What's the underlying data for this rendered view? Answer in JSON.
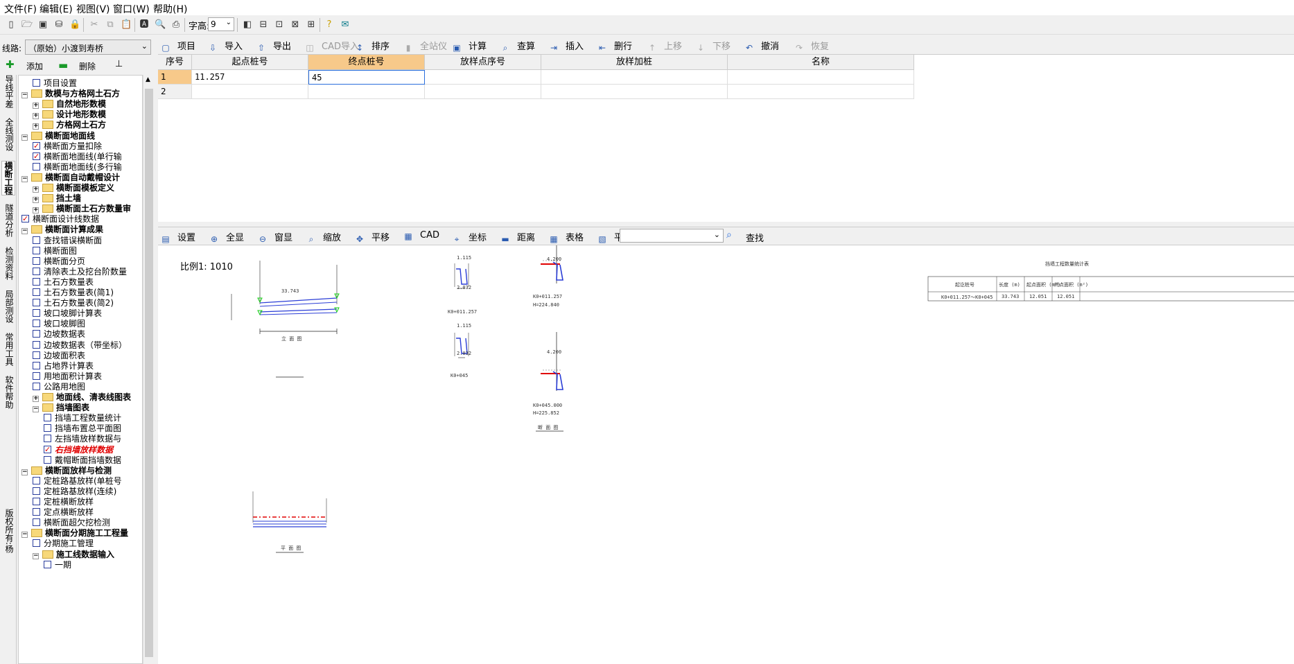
{
  "menu": [
    "文件(F)",
    "编辑(E)",
    "视图(V)",
    "窗口(W)",
    "帮助(H)"
  ],
  "toolbar1": {
    "font_height_label": "字高:",
    "font_height_value": "9"
  },
  "route": {
    "label": "线路:",
    "value": "（原始）小渡到寿桥"
  },
  "tree_actions": {
    "add": "添加",
    "delete": "删除"
  },
  "rail_tabs": [
    "导线平差",
    "全线测设",
    "横断工程",
    "隧道分析",
    "检测资料",
    "局部测设",
    "常用工具",
    "软件帮助",
    "版权所有:杨"
  ],
  "tree": [
    {
      "label": "项目设置",
      "type": "check",
      "checked": false,
      "indent": 1,
      "bold": false
    },
    {
      "label": "数模与方格网土石方",
      "type": "folder",
      "indent": 0,
      "bold": true,
      "exp": "−"
    },
    {
      "label": "自然地形数模",
      "type": "folder",
      "indent": 1,
      "bold": true,
      "exp": "+"
    },
    {
      "label": "设计地形数模",
      "type": "folder",
      "indent": 1,
      "bold": true,
      "exp": "+"
    },
    {
      "label": "方格网土石方",
      "type": "folder",
      "indent": 1,
      "bold": true,
      "exp": "+"
    },
    {
      "label": "横断面地面线",
      "type": "folder",
      "indent": 0,
      "bold": true,
      "exp": "−"
    },
    {
      "label": "横断面方量扣除",
      "type": "check",
      "checked": true,
      "indent": 1
    },
    {
      "label": "横断面地面线(单行输",
      "type": "check",
      "checked": true,
      "indent": 1
    },
    {
      "label": "横断面地面线(多行输",
      "type": "check",
      "checked": false,
      "indent": 1
    },
    {
      "label": "横断面自动戴帽设计",
      "type": "folder",
      "indent": 0,
      "bold": true,
      "exp": "−"
    },
    {
      "label": "横断面模板定义",
      "type": "folder",
      "indent": 1,
      "bold": true,
      "exp": "+"
    },
    {
      "label": "挡土墙",
      "type": "folder",
      "indent": 1,
      "bold": true,
      "exp": "+"
    },
    {
      "label": "横断面土石方数量审",
      "type": "folder",
      "indent": 1,
      "bold": true,
      "exp": "+"
    },
    {
      "label": "横断面设计线数据",
      "type": "check",
      "checked": true,
      "indent": 0
    },
    {
      "label": "横断面计算成果",
      "type": "folder",
      "indent": 0,
      "bold": true,
      "exp": "−"
    },
    {
      "label": "查找错误横断面",
      "type": "check",
      "checked": false,
      "indent": 1
    },
    {
      "label": "横断面图",
      "type": "check",
      "checked": false,
      "indent": 1
    },
    {
      "label": "横断面分页",
      "type": "check",
      "checked": false,
      "indent": 1
    },
    {
      "label": "清除表土及挖台阶数量",
      "type": "check",
      "checked": false,
      "indent": 1
    },
    {
      "label": "土石方数量表",
      "type": "check",
      "checked": false,
      "indent": 1
    },
    {
      "label": "土石方数量表(简1)",
      "type": "check",
      "checked": false,
      "indent": 1
    },
    {
      "label": "土石方数量表(简2)",
      "type": "check",
      "checked": false,
      "indent": 1
    },
    {
      "label": "坡口坡脚计算表",
      "type": "check",
      "checked": false,
      "indent": 1
    },
    {
      "label": "坡口坡脚图",
      "type": "check",
      "checked": false,
      "indent": 1
    },
    {
      "label": "边坡数据表",
      "type": "check",
      "checked": false,
      "indent": 1
    },
    {
      "label": "边坡数据表（带坐标）",
      "type": "check",
      "checked": false,
      "indent": 1
    },
    {
      "label": "边坡面积表",
      "type": "check",
      "checked": false,
      "indent": 1
    },
    {
      "label": "占地界计算表",
      "type": "check",
      "checked": false,
      "indent": 1
    },
    {
      "label": "用地面积计算表",
      "type": "check",
      "checked": false,
      "indent": 1
    },
    {
      "label": "公路用地图",
      "type": "check",
      "checked": false,
      "indent": 1
    },
    {
      "label": "地面线、清表线图表",
      "type": "folder",
      "indent": 1,
      "bold": true,
      "exp": "+"
    },
    {
      "label": "挡墙图表",
      "type": "folder",
      "indent": 1,
      "bold": true,
      "exp": "−"
    },
    {
      "label": "挡墙工程数量统计",
      "type": "check",
      "checked": false,
      "indent": 2
    },
    {
      "label": "挡墙布置总平面图",
      "type": "check",
      "checked": false,
      "indent": 2
    },
    {
      "label": "左挡墙放样数据与",
      "type": "check",
      "checked": false,
      "indent": 2
    },
    {
      "label": "右挡墙放样数据",
      "type": "check",
      "checked": true,
      "indent": 2,
      "red": true
    },
    {
      "label": "戴帽断面挡墙数据",
      "type": "check",
      "checked": false,
      "indent": 2
    },
    {
      "label": "横断面放样与检测",
      "type": "folder",
      "indent": 0,
      "bold": true,
      "exp": "−"
    },
    {
      "label": "定桩路基放样(单桩号",
      "type": "check",
      "checked": false,
      "indent": 1
    },
    {
      "label": "定桩路基放样(连续)",
      "type": "check",
      "checked": false,
      "indent": 1
    },
    {
      "label": "定桩横断放样",
      "type": "check",
      "checked": false,
      "indent": 1
    },
    {
      "label": "定点横断放样",
      "type": "check",
      "checked": false,
      "indent": 1
    },
    {
      "label": "横断面超欠挖检测",
      "type": "check",
      "checked": false,
      "indent": 1
    },
    {
      "label": "横断面分期施工工程量",
      "type": "folder",
      "indent": 0,
      "bold": true,
      "exp": "−"
    },
    {
      "label": "分期施工管理",
      "type": "check",
      "checked": false,
      "indent": 1
    },
    {
      "label": "施工线数据输入",
      "type": "folder",
      "indent": 1,
      "bold": true,
      "exp": "−"
    },
    {
      "label": "一期",
      "type": "check",
      "checked": false,
      "indent": 2
    }
  ],
  "toolbar2": [
    {
      "label": "项目",
      "icon": "project-icon",
      "glyph": "▢",
      "enabled": true
    },
    {
      "label": "导入",
      "icon": "import-icon",
      "glyph": "⇩",
      "enabled": true
    },
    {
      "label": "导出",
      "icon": "export-icon",
      "glyph": "⇧",
      "enabled": true
    },
    {
      "label": "CAD导入",
      "icon": "cad-import-icon",
      "glyph": "◫",
      "enabled": false
    },
    {
      "label": "排序",
      "icon": "sort-icon",
      "glyph": "↕",
      "enabled": true
    },
    {
      "label": "全站仪",
      "icon": "total-station-icon",
      "glyph": "▮",
      "enabled": false
    },
    {
      "label": "计算",
      "icon": "calculate-icon",
      "glyph": "▣",
      "enabled": true
    },
    {
      "label": "查算",
      "icon": "find-calc-icon",
      "glyph": "⌕",
      "enabled": true
    },
    {
      "label": "插入",
      "icon": "insert-icon",
      "glyph": "⇥",
      "enabled": true
    },
    {
      "label": "删行",
      "icon": "delete-row-icon",
      "glyph": "⇤",
      "enabled": true
    },
    {
      "label": "上移",
      "icon": "move-up-icon",
      "glyph": "↑",
      "enabled": false
    },
    {
      "label": "下移",
      "icon": "move-down-icon",
      "glyph": "↓",
      "enabled": false
    },
    {
      "label": "撤消",
      "icon": "undo-icon",
      "glyph": "↶",
      "enabled": true
    },
    {
      "label": "恢复",
      "icon": "redo-icon",
      "glyph": "↷",
      "enabled": false
    }
  ],
  "grid": {
    "headers": [
      "序号",
      "起点桩号",
      "终点桩号",
      "放样点序号",
      "放样加桩",
      "名称"
    ],
    "rows": [
      {
        "num": "1",
        "start": "11.257",
        "end": "45",
        "point": "",
        "station": "",
        "name": ""
      },
      {
        "num": "2",
        "start": "",
        "end": "",
        "point": "",
        "station": "",
        "name": ""
      }
    ]
  },
  "toolbar3": [
    {
      "label": "设置",
      "icon": "settings-icon",
      "glyph": "▤"
    },
    {
      "label": "全显",
      "icon": "zoom-all-icon",
      "glyph": "⊕"
    },
    {
      "label": "窗显",
      "icon": "zoom-window-icon",
      "glyph": "⊖"
    },
    {
      "label": "缩放",
      "icon": "zoom-icon",
      "glyph": "⌕"
    },
    {
      "label": "平移",
      "icon": "pan-icon",
      "glyph": "✥"
    },
    {
      "label": "CAD",
      "icon": "cad-icon",
      "glyph": "▦"
    },
    {
      "label": "坐标",
      "icon": "coordinate-icon",
      "glyph": "⌖"
    },
    {
      "label": "距离",
      "icon": "distance-icon",
      "glyph": "▬"
    },
    {
      "label": "表格",
      "icon": "table-icon",
      "glyph": "▦"
    },
    {
      "label": "平面图",
      "icon": "plan-view-icon",
      "glyph": "▧"
    }
  ],
  "find_label": "查找",
  "drawing": {
    "scale": "比例1: 1010",
    "elev_label": "立 面 图",
    "section_label": "断 面 图",
    "plan_label": "平 面 图",
    "length": "33.743",
    "sec1_station": "K0+011.257",
    "sec2_station": "K0+045",
    "sec1_h": "H=224.840",
    "sec2_h": "H=225.852",
    "sec1_station_full": "K0+011.257",
    "sec2_station_full": "K0+045.000",
    "dim_1115": "1.115",
    "dim_2032": "2.032",
    "dim_4200": "4.200",
    "table_title": "挡墙工程数量统计表",
    "table_headers": [
      "起讫桩号",
      "长度 (m)",
      "起点面积 (m²)",
      "终点面积 (m²)"
    ],
    "table_row": [
      "K0+011.257～K0+045",
      "33.743",
      "12.051",
      "12.051"
    ]
  }
}
